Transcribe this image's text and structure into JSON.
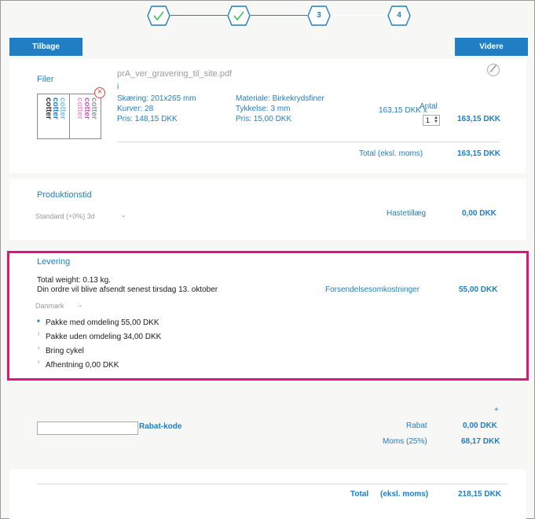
{
  "steps": [
    {
      "label": "",
      "state": "done"
    },
    {
      "label": "",
      "state": "done"
    },
    {
      "label": "3",
      "state": "active"
    },
    {
      "label": "4",
      "state": "pending"
    }
  ],
  "nav": {
    "back_label": "Tilbage",
    "next_label": "Videre"
  },
  "files": {
    "section_title": "Filer",
    "file_name": "prA_ver_gravering_til_site.pdf",
    "info_mark": "i",
    "cut": "Skæring: 201x265 mm",
    "curves": "Kurver: 28",
    "price": "Pris: 148,15 DKK",
    "material": "Materiale: Birkekrydsfiner",
    "thickness": "Tykkelse: 3 mm",
    "material_price": "Pris: 15,00 DKK",
    "unit_total": "163,15 DKK x",
    "qty_label": "Antal",
    "qty_value": "1",
    "line_total": "163,15 DKK",
    "total_label": "Total (eksl. moms)",
    "total_value": "163,15 DKK",
    "thumb_word": "cotter"
  },
  "production": {
    "section_title": "Produktionstid",
    "select_value": "Standard (+0%) 3d",
    "rush_label": "Hastetillæg",
    "rush_value": "0,00 DKK"
  },
  "delivery": {
    "section_title": "Levering",
    "weight": "Total weight: 0.13 kg.",
    "ship_date": "Din ordre vil blive afsendt senest tirsdag 13. oktober",
    "country": "Danmark",
    "shipping_label": "Forsendelsesomkostninger",
    "shipping_value": "55,00 DKK",
    "options": [
      {
        "label": "Pakke med omdeling 55,00 DKK",
        "mark": "■"
      },
      {
        "label": "Pakke uden omdeling 34,00 DKK",
        "mark": "╵"
      },
      {
        "label": "Bring cykel",
        "mark": "╵"
      },
      {
        "label": "Afhentning 0,00 DKK",
        "mark": "╵"
      }
    ],
    "highlight_color": "#e0157a"
  },
  "discount": {
    "plus": "+",
    "code_label": "Rabat-kode",
    "code_value": "",
    "rabat_label": "Rabat",
    "rabat_value": "0,00 DKK",
    "vat_label": "Moms (25%)",
    "vat_value": "68,17 DKK"
  },
  "summary": {
    "total_label": "Total",
    "total_sub": "(eksl. moms)",
    "total_value": "218,15 DKK"
  },
  "colors": {
    "accent": "#1f7ec4",
    "highlight": "#e0157a"
  }
}
